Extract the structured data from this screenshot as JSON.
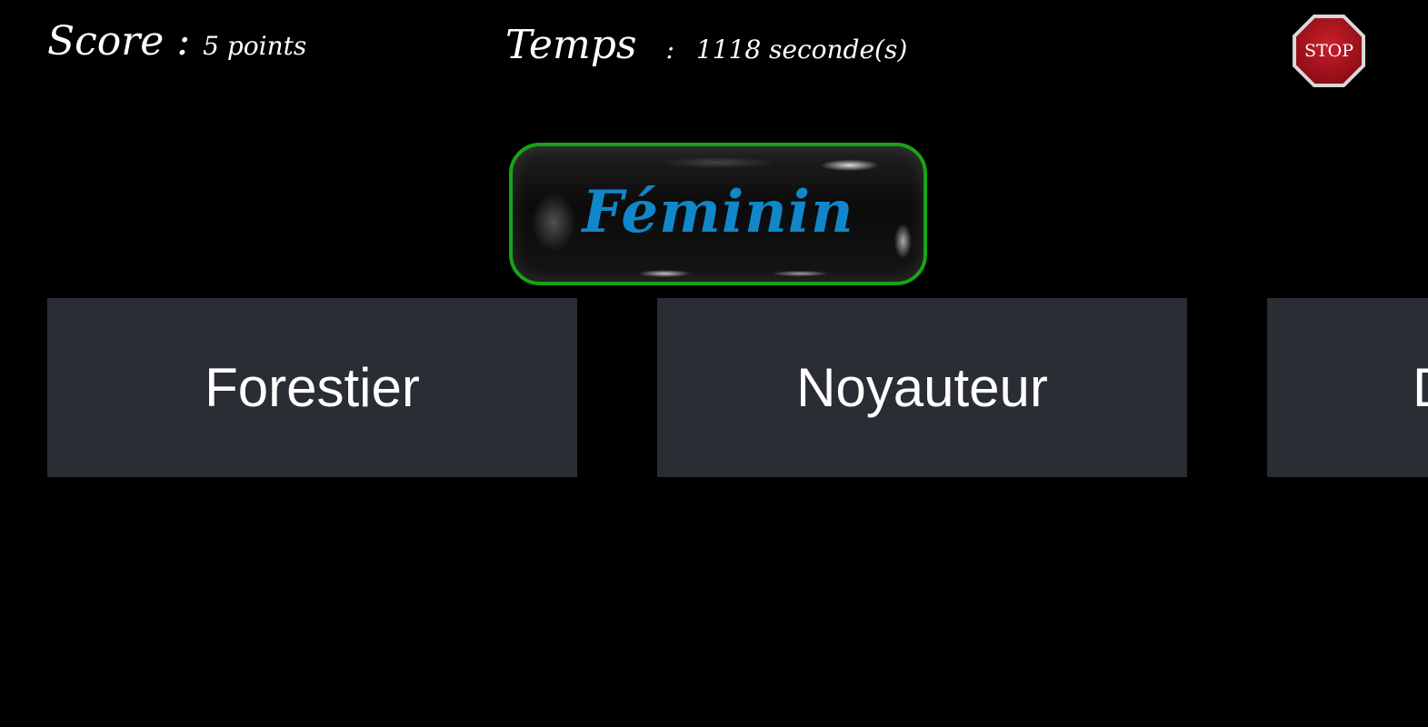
{
  "header": {
    "score_label": "Score :",
    "score_value": "5 points",
    "time_label": "Temps",
    "time_separator": ":",
    "time_value": "1118 seconde(s)"
  },
  "stop_button": {
    "label": "STOP",
    "icon": "stop-sign-icon",
    "color": "#b0141e"
  },
  "prompt": {
    "word": "Féminin",
    "text_color": "#1187c9",
    "border_color": "#14a614"
  },
  "answers": [
    {
      "label": "Forestier"
    },
    {
      "label": "Noyauteur"
    },
    {
      "label": "D"
    }
  ],
  "colors": {
    "background": "#000000",
    "answer_background": "#2b2d35"
  }
}
